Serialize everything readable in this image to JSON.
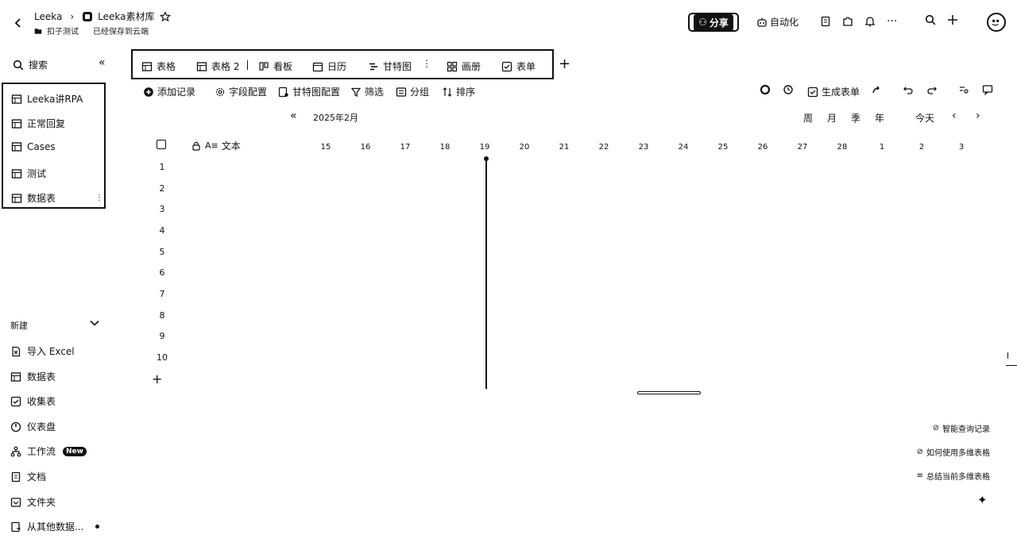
{
  "header": {
    "back_icon": "chevron-left-icon",
    "workspace": "Leeka",
    "base_name": "Leeka素材库",
    "folder": "扣子测试",
    "save_status": "已经保存到云端",
    "share_label": "分享",
    "automation_label": "自动化"
  },
  "sidebar": {
    "search_label": "搜索",
    "tables": [
      {
        "label": "Leeka讲RPA"
      },
      {
        "label": "正常回复"
      },
      {
        "label": "Cases"
      },
      {
        "label": "测试"
      },
      {
        "label": "数据表"
      }
    ],
    "new_header": "新建",
    "new_items": [
      {
        "label": "导入 Excel",
        "icon": "excel-icon"
      },
      {
        "label": "数据表",
        "icon": "table-icon"
      },
      {
        "label": "收集表",
        "icon": "form-icon"
      },
      {
        "label": "仪表盘",
        "icon": "dashboard-icon"
      },
      {
        "label": "工作流",
        "icon": "workflow-icon",
        "badge": "New"
      },
      {
        "label": "文档",
        "icon": "doc-icon"
      },
      {
        "label": "文件夹",
        "icon": "folder-icon"
      },
      {
        "label": "从其他数据...",
        "icon": "import-icon"
      }
    ]
  },
  "views": [
    {
      "label": "表格"
    },
    {
      "label": "表格 2"
    },
    {
      "label": "看板"
    },
    {
      "label": "日历"
    },
    {
      "label": "甘特图"
    },
    {
      "label": "画册"
    },
    {
      "label": "表单"
    }
  ],
  "toolbar": {
    "add_record": "添加记录",
    "field_config": "字段配置",
    "gantt_config": "甘特图配置",
    "filter": "筛选",
    "group": "分组",
    "sort": "排序",
    "generate_form": "生成表单"
  },
  "gantt": {
    "month": "2025年2月",
    "zoom": [
      "周",
      "月",
      "季",
      "年"
    ],
    "today": "今天",
    "column_header": "文本",
    "days": [
      "15",
      "16",
      "17",
      "18",
      "19",
      "20",
      "21",
      "22",
      "23",
      "24",
      "25",
      "26",
      "27",
      "28",
      "1",
      "2",
      "3"
    ],
    "rows": [
      "1",
      "2",
      "3",
      "4",
      "5",
      "6",
      "7",
      "8",
      "9",
      "10"
    ]
  },
  "ai_suggestions": [
    "智能查询记录",
    "如何使用多维表格",
    "总结当前多维表格"
  ]
}
